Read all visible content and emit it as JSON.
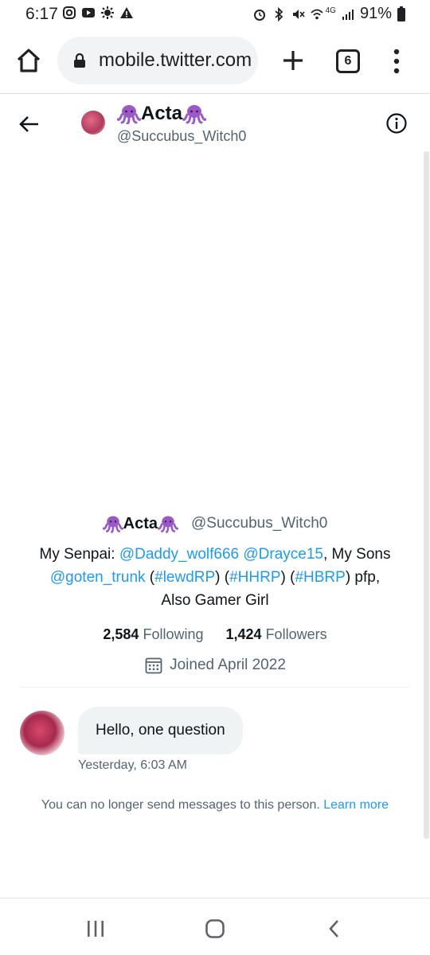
{
  "status_bar": {
    "time": "6:17",
    "battery": "91%",
    "network": "4G"
  },
  "browser": {
    "url": "mobile.twitter.com",
    "tab_count": "6"
  },
  "header": {
    "display_name": "Acta",
    "handle": "@Succubus_Witch0"
  },
  "profile": {
    "display_name": "Acta",
    "handle": "@Succubus_Witch0",
    "bio": {
      "senpai_label": "My Senpai: ",
      "mention_1": "@Daddy_wolf666",
      "space": " ",
      "mention_2": "@Drayce15",
      "sons_label": ", My Sons ",
      "mention_3": "@goten_trunk",
      "open_1": " (",
      "tag_1": "#lewdRP",
      "close_open_2": ") (",
      "tag_2": "#HHRP",
      "close_open_3": ") (",
      "tag_3": "#HBRP",
      "tail": ") pfp, Also Gamer Girl"
    },
    "following_count": "2,584",
    "following_label": "Following",
    "followers_count": "1,424",
    "followers_label": "Followers",
    "joined": "Joined April 2022"
  },
  "message": {
    "text": "Hello, one question",
    "timestamp": "Yesterday, 6:03 AM"
  },
  "notice": {
    "text": "You can no longer send messages to this person. ",
    "link": "Learn more"
  },
  "colors": {
    "accent": "#1d9bf0",
    "octopus": "#9b59c6",
    "secondary_text": "#536471"
  },
  "icons": {
    "home": "home-icon",
    "lock": "lock-icon",
    "new_tab": "plus-icon",
    "menu": "more-vertical-icon",
    "back": "arrow-left-icon",
    "info": "info-icon",
    "calendar": "calendar-icon",
    "octopus": "octopus-emoji"
  }
}
